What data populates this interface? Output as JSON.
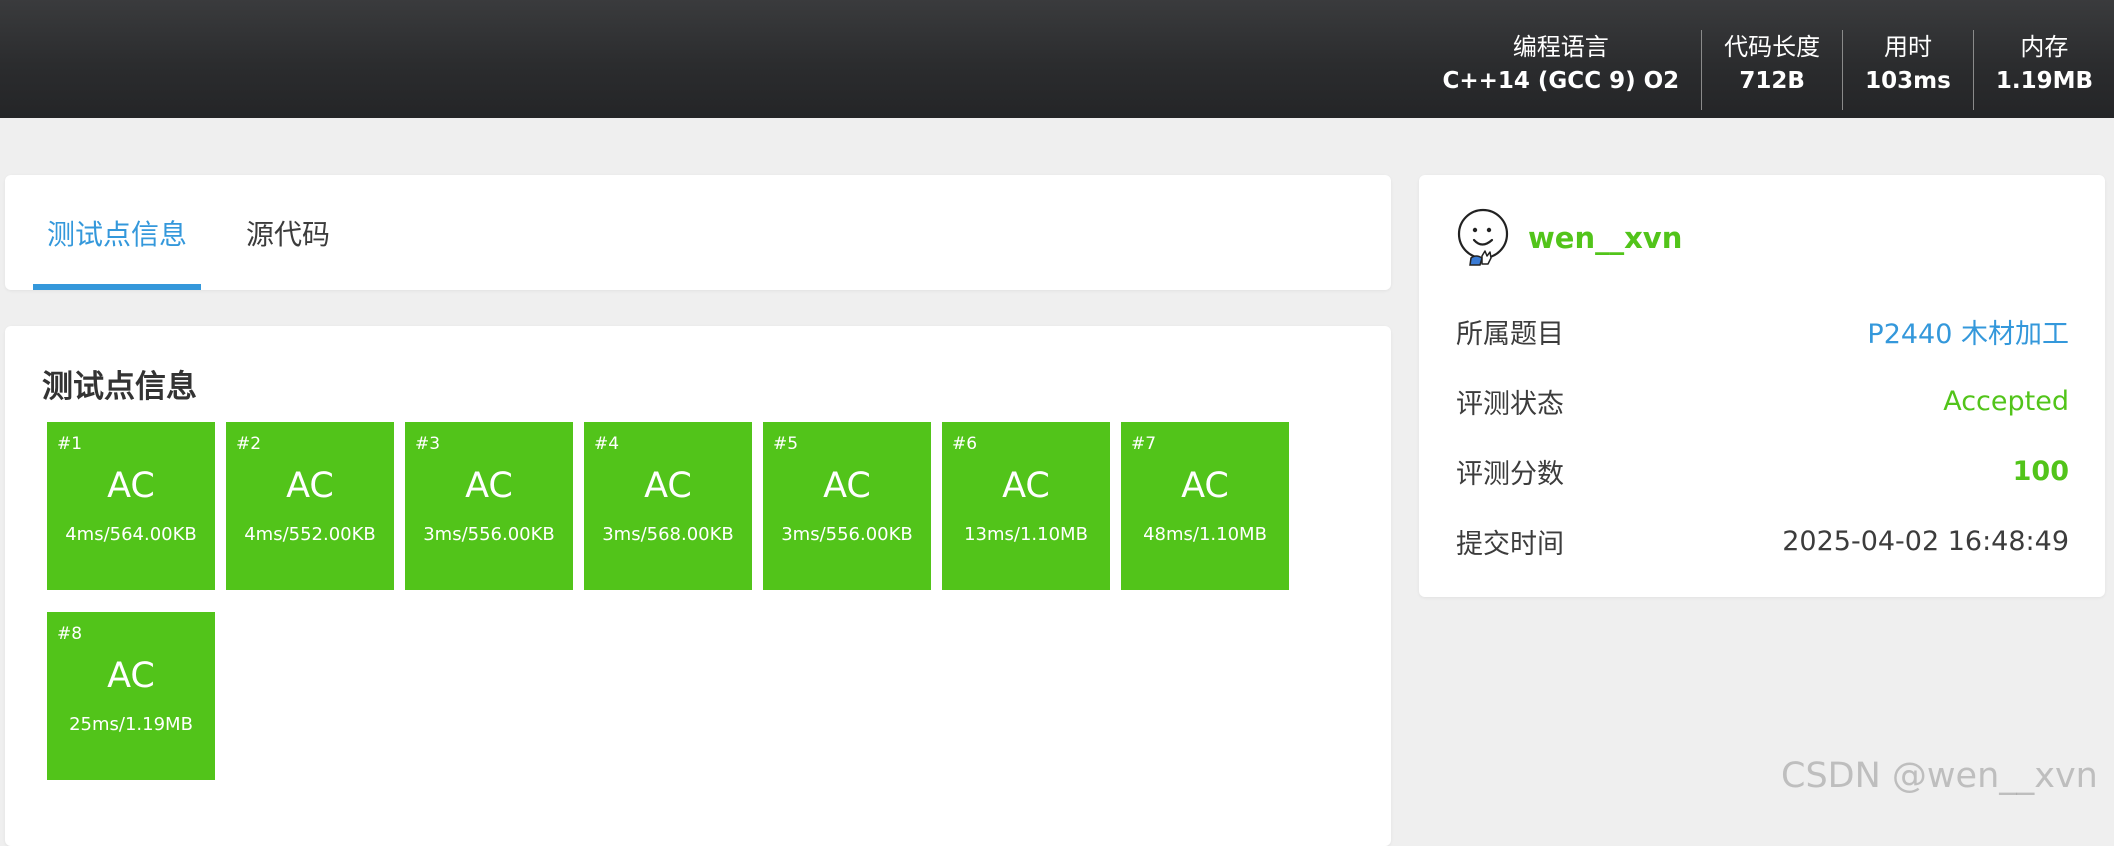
{
  "header": {
    "stats": [
      {
        "label": "编程语言",
        "value": "C++14 (GCC 9) O2"
      },
      {
        "label": "代码长度",
        "value": "712B"
      },
      {
        "label": "用时",
        "value": "103ms"
      },
      {
        "label": "内存",
        "value": "1.19MB"
      }
    ]
  },
  "tabs": [
    {
      "label": "测试点信息",
      "active": true
    },
    {
      "label": "源代码",
      "active": false
    }
  ],
  "cases_section": {
    "title": "测试点信息",
    "cases": [
      {
        "id": "#1",
        "status": "AC",
        "detail": "4ms/564.00KB"
      },
      {
        "id": "#2",
        "status": "AC",
        "detail": "4ms/552.00KB"
      },
      {
        "id": "#3",
        "status": "AC",
        "detail": "3ms/556.00KB"
      },
      {
        "id": "#4",
        "status": "AC",
        "detail": "3ms/568.00KB"
      },
      {
        "id": "#5",
        "status": "AC",
        "detail": "3ms/556.00KB"
      },
      {
        "id": "#6",
        "status": "AC",
        "detail": "13ms/1.10MB"
      },
      {
        "id": "#7",
        "status": "AC",
        "detail": "48ms/1.10MB"
      },
      {
        "id": "#8",
        "status": "AC",
        "detail": "25ms/1.19MB"
      }
    ]
  },
  "info": {
    "username": "wen__xvn",
    "rows": [
      {
        "label": "所属题目",
        "value": "P2440 木材加工"
      },
      {
        "label": "评测状态",
        "value": "Accepted"
      },
      {
        "label": "评测分数",
        "value": "100"
      },
      {
        "label": "提交时间",
        "value": "2025-04-02 16:48:49"
      }
    ]
  },
  "watermark": "CSDN @wen__xvn",
  "colors": {
    "accent": "#3498db",
    "success": "#52c41a",
    "header_bg": "#2b2c2e",
    "page_bg": "#efefef"
  }
}
